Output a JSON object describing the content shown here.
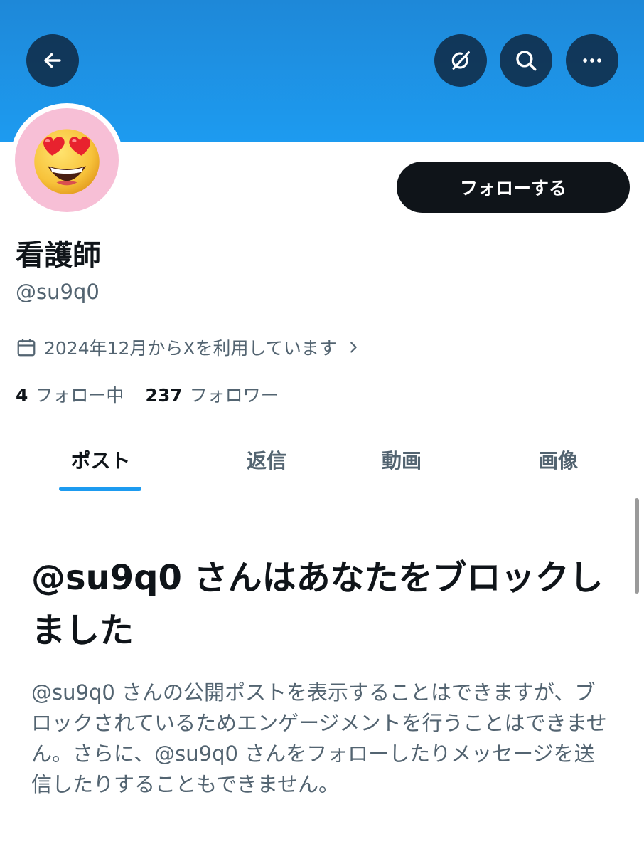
{
  "header": {
    "back_icon": "arrow-left-icon",
    "grok_icon": "grok-icon",
    "search_icon": "search-icon",
    "more_icon": "more-horizontal-icon"
  },
  "profile": {
    "display_name": "看護師",
    "handle": "@su9q0",
    "avatar_icon": "heart-eyes-emoji",
    "joined_text": "2024年12月からXを利用しています",
    "follow_button_label": "フォローする"
  },
  "stats": {
    "following_count": "4",
    "following_label": "フォロー中",
    "followers_count": "237",
    "followers_label": "フォロワー"
  },
  "tabs": [
    {
      "label": "ポスト",
      "active": true
    },
    {
      "label": "返信",
      "active": false
    },
    {
      "label": "動画",
      "active": false
    },
    {
      "label": "画像",
      "active": false
    }
  ],
  "blocked_notice": {
    "title": "@su9q0 さんはあなたをブロックしました",
    "description": "@su9q0 さんの公開ポストを表示することはできますが、ブロックされているためエンゲージメントを行うことはできません。さらに、@su9q0 さんをフォローしたりメッセージを送信したりすることもできません。"
  },
  "colors": {
    "accent": "#1d9bf0",
    "text_primary": "#0f1419",
    "text_secondary": "#536471",
    "avatar_bg": "#f7bfd6"
  }
}
